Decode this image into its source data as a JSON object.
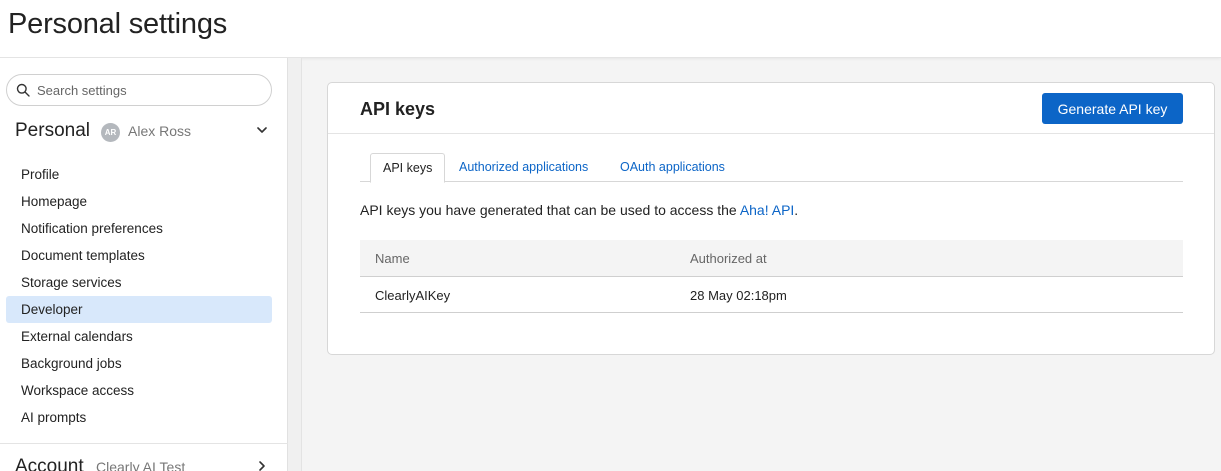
{
  "page": {
    "title": "Personal settings"
  },
  "search": {
    "placeholder": "Search settings"
  },
  "sidebar": {
    "section": {
      "title": "Personal",
      "user_initials": "AR",
      "user_name": "Alex Ross"
    },
    "items": [
      {
        "label": "Profile"
      },
      {
        "label": "Homepage"
      },
      {
        "label": "Notification preferences"
      },
      {
        "label": "Document templates"
      },
      {
        "label": "Storage services"
      },
      {
        "label": "Developer",
        "active": true
      },
      {
        "label": "External calendars"
      },
      {
        "label": "Background jobs"
      },
      {
        "label": "Workspace access"
      },
      {
        "label": "AI prompts"
      }
    ],
    "account": {
      "title": "Account",
      "subtitle": "Clearly AI Test"
    }
  },
  "card": {
    "title": "API keys",
    "generate_label": "Generate API key",
    "tabs": [
      {
        "label": "API keys",
        "active": true
      },
      {
        "label": "Authorized applications"
      },
      {
        "label": "OAuth applications"
      }
    ],
    "description_prefix": "API keys you have generated that can be used to access the ",
    "description_link": "Aha! API",
    "description_suffix": ".",
    "table": {
      "headers": [
        "Name",
        "Authorized at"
      ],
      "rows": [
        [
          "ClearlyAIKey",
          "28 May 02:18pm"
        ]
      ]
    }
  },
  "colors": {
    "accent": "#0c65c7",
    "active_nav": "#d8e8fb"
  }
}
